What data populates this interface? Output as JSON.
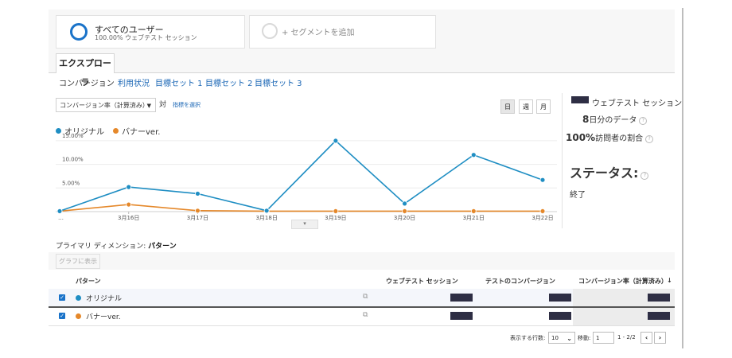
{
  "segments": {
    "all_users": {
      "title": "すべてのユーザー",
      "subtitle": "100.00% ウェブテスト セッション"
    },
    "add": {
      "label": "+ セグメントを追加"
    }
  },
  "explorer_tab": "エクスプローラ",
  "subtabs": [
    "コンバージョン",
    "利用状況",
    "目標セット 1",
    "目標セット 2",
    "目標セット 3"
  ],
  "metric_select": {
    "value": "コンバージョン率（計算済み）",
    "vs": "対",
    "pick": "指標を選択"
  },
  "period_buttons": [
    "日",
    "週",
    "月"
  ],
  "legend": [
    {
      "name": "オリジナル",
      "color": "#1f8ec3"
    },
    {
      "name": "バナーver.",
      "color": "#e5882a"
    }
  ],
  "chart_data": {
    "type": "line",
    "categories": [
      "…",
      "3月16日",
      "3月17日",
      "3月18日",
      "3月19日",
      "3月20日",
      "3月21日",
      "3月22日"
    ],
    "x": [
      15,
      16,
      17,
      18,
      19,
      20,
      21,
      22
    ],
    "series": [
      {
        "name": "オリジナル",
        "color": "#1f8ec3",
        "values": [
          0.1,
          5.2,
          3.8,
          0.2,
          15.0,
          1.7,
          12.0,
          6.7
        ]
      },
      {
        "name": "バナーver.",
        "color": "#e5882a",
        "values": [
          0.1,
          1.5,
          0.2,
          0.1,
          0.1,
          0.1,
          0.1,
          0.1
        ]
      }
    ],
    "ylim": [
      0,
      16.5
    ],
    "yticks": [
      5,
      10,
      15
    ],
    "ytick_labels": [
      "5.00%",
      "10.00%",
      "15.00%"
    ],
    "xtick_labels": [
      "…",
      "3月16日",
      "3月17日",
      "3月18日",
      "3月19日",
      "3月20日",
      "3月21日",
      "3月22日"
    ],
    "grid": true
  },
  "info": {
    "title": "ウェブテスト セッション",
    "days_num": "8",
    "days_text": "日分のデータ",
    "pct_num": "100%",
    "pct_text": "訪問者の割合",
    "status_label": "ステータス:",
    "status_value": "終了",
    "help": "?"
  },
  "handle": "▾",
  "primary_dimension": {
    "label": "プライマリ ディメンション:",
    "value": "パターン"
  },
  "graph_button": "グラフに表示",
  "table": {
    "headers": [
      "パターン",
      "ウェブテスト セッション",
      "テストのコンバージョン",
      "コンバージョン率（計算済み）"
    ],
    "sort_icon": "↓",
    "rows": [
      {
        "label": "オリジナル",
        "color": "#1f8ec3"
      },
      {
        "label": "バナーver.",
        "color": "#e5882a"
      }
    ]
  },
  "pager": {
    "rows_label": "表示する行数:",
    "rows_value": "10",
    "goto_label": "移動:",
    "goto_value": "1",
    "range": "1 - 2/2",
    "prev": "‹",
    "next": "›"
  }
}
